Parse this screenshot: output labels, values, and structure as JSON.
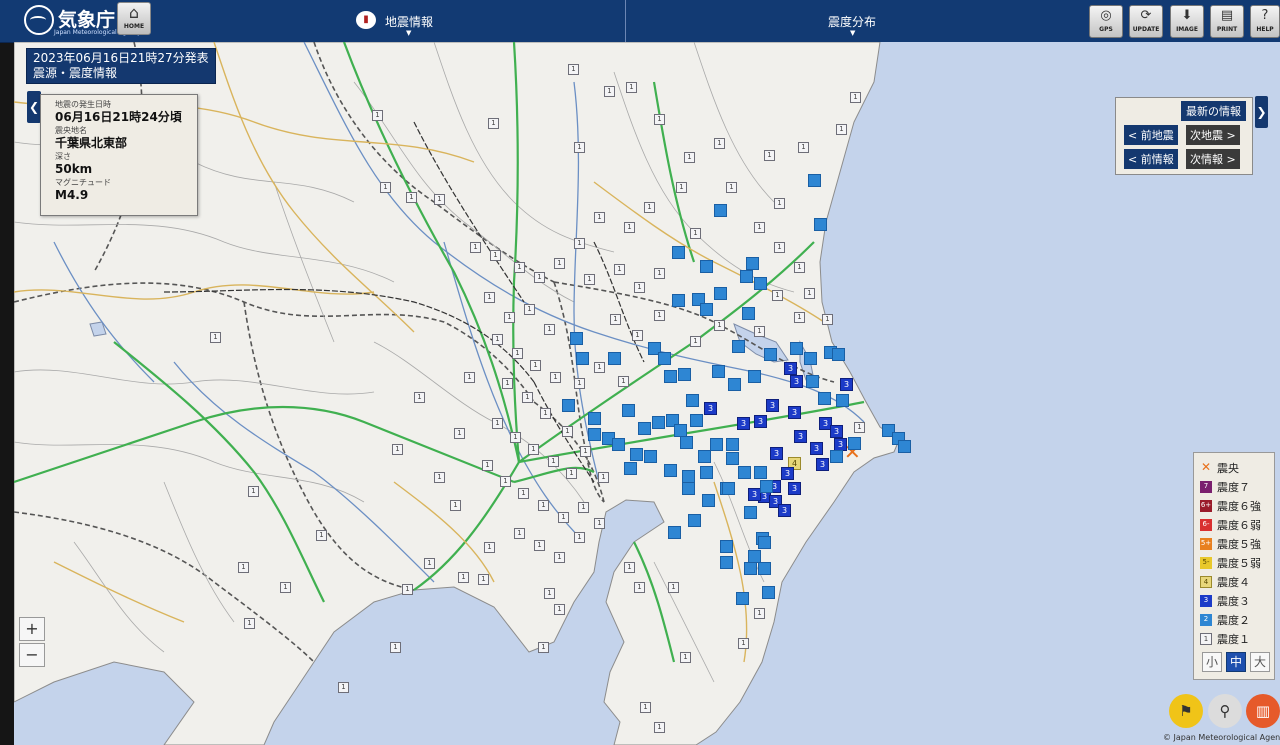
{
  "header": {
    "logo_text": "気象庁",
    "logo_sub": "Japan Meteorological Agency",
    "home_label": "HOME",
    "tab_eq_info": "地震情報",
    "tab_shindo": "震度分布",
    "tools": [
      {
        "icon": "◎",
        "label": "GPS",
        "name": "gps-button"
      },
      {
        "icon": "⟳",
        "label": "UPDATE",
        "name": "update-button"
      },
      {
        "icon": "⬇",
        "label": "IMAGE",
        "name": "image-button"
      },
      {
        "icon": "▤",
        "label": "PRINT",
        "name": "print-button"
      },
      {
        "icon": "?",
        "label": "HELP",
        "name": "help-button"
      }
    ]
  },
  "title": {
    "line1": "2023年06月16日21時27分発表",
    "line2": "震源・震度情報"
  },
  "quake": {
    "time_label": "地震の発生日時",
    "time": "06月16日21時24分頃",
    "region_label": "震央地名",
    "region": "千葉県北東部",
    "depth_label": "深さ",
    "depth": "50km",
    "magnitude_label": "マグニチュード",
    "magnitude": "M4.9"
  },
  "nav": {
    "latest": "最新の情報",
    "prev_quake": "< 前地震",
    "next_quake": "次地震 >",
    "prev_info": "< 前情報",
    "next_info": "次情報 >"
  },
  "legend": {
    "items": [
      {
        "label": "震央",
        "code": "✕",
        "color": "#e8701a"
      },
      {
        "label": "震度７",
        "code": "7",
        "color": "#7a1f6e"
      },
      {
        "label": "震度６強",
        "code": "6+",
        "color": "#9a1b2a"
      },
      {
        "label": "震度６弱",
        "code": "6-",
        "color": "#d93030"
      },
      {
        "label": "震度５強",
        "code": "5+",
        "color": "#e8801f"
      },
      {
        "label": "震度５弱",
        "code": "5-",
        "color": "#e8c82a"
      },
      {
        "label": "震度４",
        "code": "4",
        "color": "#e8d77a"
      },
      {
        "label": "震度３",
        "code": "3",
        "color": "#1c3bc8"
      },
      {
        "label": "震度２",
        "code": "2",
        "color": "#2e86d3"
      },
      {
        "label": "震度１",
        "code": "1",
        "color": "#f4f4f6"
      }
    ],
    "sizes": [
      "小",
      "中",
      "大"
    ],
    "size_selected": "中"
  },
  "zoom": {
    "in": "+",
    "out": "−"
  },
  "copyright": "© Japan Meteorological Agency",
  "stations": {
    "intensity_4": "4",
    "intensity_3": "3",
    "intensity_1": "1"
  }
}
